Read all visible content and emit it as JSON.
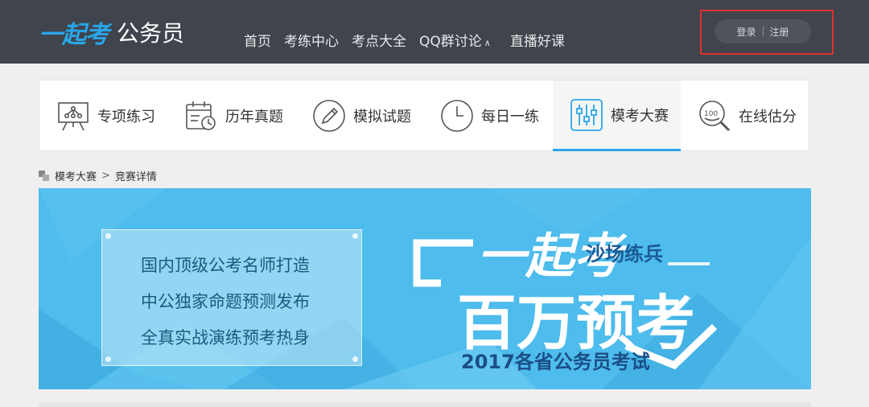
{
  "header": {
    "logo_mark": "一起考",
    "logo_sub": "公务员",
    "nav": [
      "首页",
      "考练中心",
      "考点大全",
      "QQ群讨论",
      "直播好课"
    ],
    "qq_caret": "∧",
    "login": "登录",
    "register": "注册"
  },
  "tabs": [
    {
      "label": "专项练习",
      "icon": "presentation-board-icon"
    },
    {
      "label": "历年真题",
      "icon": "calendar-clock-icon"
    },
    {
      "label": "模拟试题",
      "icon": "pencil-circle-icon"
    },
    {
      "label": "每日一练",
      "icon": "clock-icon"
    },
    {
      "label": "模考大赛",
      "icon": "sliders-icon",
      "active": true
    },
    {
      "label": "在线估分",
      "icon": "score-magnifier-icon"
    }
  ],
  "breadcrumb": {
    "root": "模考大赛",
    "separator": ">",
    "current": "竞赛详情"
  },
  "banner": {
    "lines": [
      "国内顶级公考名师打造",
      "中公独家命题预测发布",
      "全真实战演练预考热身"
    ],
    "brand": "一起考",
    "tag": "沙场练兵",
    "headline": "百万预考",
    "subtitle": "2017各省公务员考试"
  },
  "colors": {
    "header_bg": "#3f444d",
    "accent": "#2aa6e8",
    "banner_bg": "#4ebcec",
    "highlight_border": "#e0312b"
  }
}
